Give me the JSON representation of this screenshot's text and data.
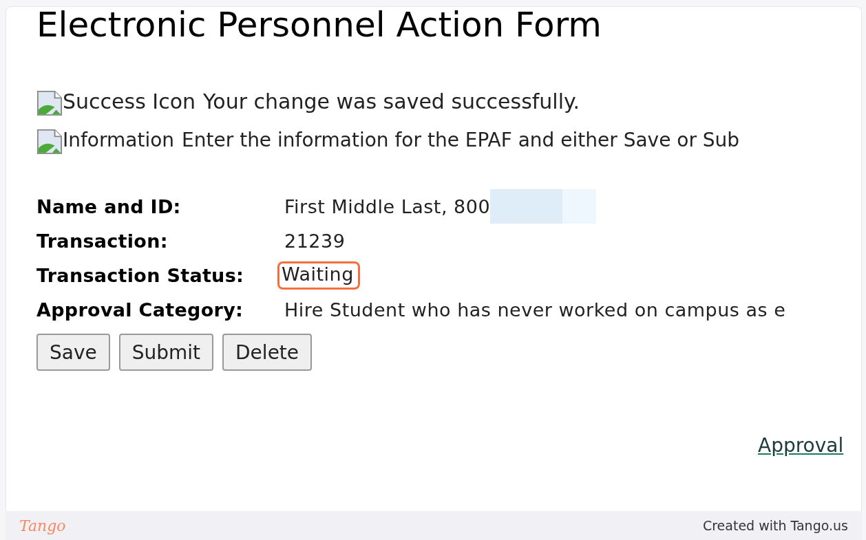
{
  "page": {
    "title": "Electronic Personnel Action Form"
  },
  "messages": [
    {
      "kind": "success",
      "icon_alt": "Success Icon",
      "text": "Your change was saved successfully."
    },
    {
      "kind": "info",
      "icon_alt": "Information",
      "text": "Enter the information for the EPAF and either Save or Sub"
    }
  ],
  "fields": [
    {
      "label": "Name and ID:",
      "value": "First Middle Last, 800",
      "redacted": true,
      "highlighted": false
    },
    {
      "label": "Transaction:",
      "value": "21239",
      "redacted": false,
      "highlighted": false
    },
    {
      "label": "Transaction Status:",
      "value": "Waiting",
      "redacted": false,
      "highlighted": true
    },
    {
      "label": "Approval Category:",
      "value": "Hire Student who has never worked on campus as e",
      "redacted": false,
      "highlighted": false
    }
  ],
  "buttons": [
    "Save",
    "Submit",
    "Delete"
  ],
  "link": "Approval",
  "footer": {
    "logo": "Tango",
    "credit": "Created with Tango.us"
  }
}
